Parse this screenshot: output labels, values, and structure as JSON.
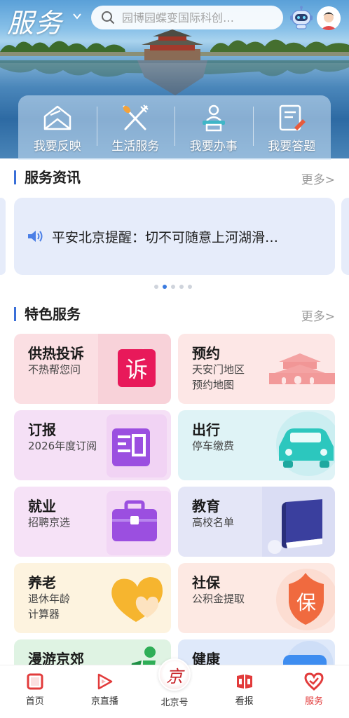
{
  "header": {
    "brand": "服务",
    "search_placeholder": "园博园蝶变国际科创…"
  },
  "quick_actions": [
    {
      "label": "我要反映",
      "icon": "envelope-icon"
    },
    {
      "label": "生活服务",
      "icon": "fork-knife-icon"
    },
    {
      "label": "我要办事",
      "icon": "service-person-icon"
    },
    {
      "label": "我要答题",
      "icon": "quiz-pencil-icon"
    }
  ],
  "service_news": {
    "title": "服务资讯",
    "more": "更多>",
    "item": "平安北京提醒：切不可随意上河湖滑…",
    "page_count": 5,
    "active_page": 1
  },
  "featured": {
    "title": "特色服务",
    "more": "更多>",
    "cards": [
      {
        "title": "供热投诉",
        "subtitle": "不热帮您问",
        "icon": "complaint-icon",
        "icon_text": "诉",
        "bg": "#fbdfe3"
      },
      {
        "title": "预约",
        "subtitle": "天安门地区\n预约地图",
        "icon": "tiananmen-icon",
        "bg": "#fde7e6"
      },
      {
        "title": "订报",
        "subtitle": "2026年度订阅",
        "icon": "newspaper-icon",
        "bg": "#f5e0f6"
      },
      {
        "title": "出行",
        "subtitle": "停车缴费",
        "icon": "car-icon",
        "bg": "#dff3f6"
      },
      {
        "title": "就业",
        "subtitle": "招聘京选",
        "icon": "briefcase-icon",
        "bg": "#f6e2f7"
      },
      {
        "title": "教育",
        "subtitle": "高校名单",
        "icon": "book-icon",
        "bg": "#e4e6f7"
      },
      {
        "title": "养老",
        "subtitle": "退休年龄\n计算器",
        "icon": "heart-icon",
        "bg": "#fdf3df"
      },
      {
        "title": "社保",
        "subtitle": "公积金提取",
        "icon": "social-security-icon",
        "icon_text": "保",
        "bg": "#fde9e3"
      },
      {
        "title": "漫游京郊",
        "subtitle": "",
        "icon": "hiking-icon",
        "bg": "#dff3e3"
      },
      {
        "title": "健康",
        "subtitle": "",
        "icon": "health-icon",
        "bg": "#dfe9fa"
      }
    ]
  },
  "tabbar": [
    {
      "label": "首页",
      "active": false
    },
    {
      "label": "京直播",
      "active": false
    },
    {
      "label": "北京号",
      "active": false,
      "badge_text": "京"
    },
    {
      "label": "看报",
      "active": false
    },
    {
      "label": "服务",
      "active": true
    }
  ],
  "colors": {
    "accent": "#3a6fd8",
    "active_tab": "#e23b3b"
  }
}
